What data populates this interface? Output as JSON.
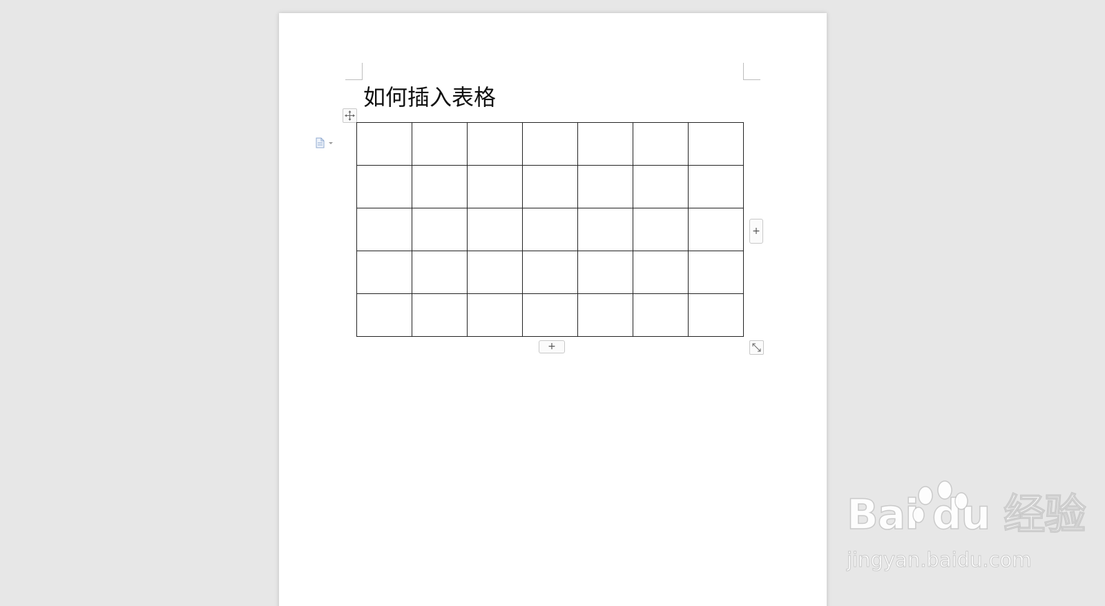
{
  "document": {
    "title": "如何插入表格",
    "table": {
      "rows": 5,
      "columns": 7,
      "cells": [
        [
          "",
          "",
          "",
          "",
          "",
          "",
          ""
        ],
        [
          "",
          "",
          "",
          "",
          "",
          "",
          ""
        ],
        [
          "",
          "",
          "",
          "",
          "",
          "",
          ""
        ],
        [
          "",
          "",
          "",
          "",
          "",
          "",
          ""
        ],
        [
          "",
          "",
          "",
          "",
          "",
          "",
          ""
        ]
      ]
    }
  },
  "controls": {
    "add_column_label": "+",
    "add_row_label": "+"
  },
  "icons": {
    "move": "move-arrows-icon",
    "paragraph": "document-icon",
    "resize": "diagonal-resize-icon"
  },
  "watermark": {
    "logo_text": "Bai  du 经验",
    "url": "jingyan.baidu.com"
  },
  "colors": {
    "background": "#e7e7e7",
    "page": "#ffffff",
    "table_border": "#222222"
  }
}
